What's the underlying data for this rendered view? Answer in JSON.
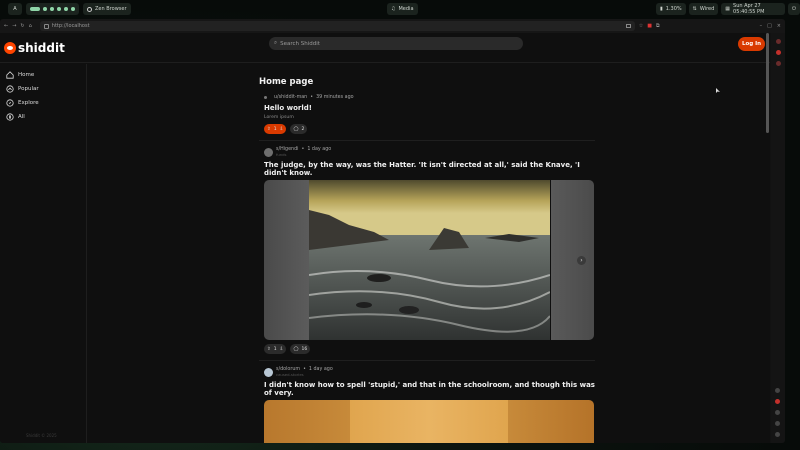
{
  "topbar": {
    "workspace": "A",
    "app_name": "Zen Browser",
    "media": "Media",
    "battery": "1.30%",
    "network": "Wired",
    "datetime": "Sun Apr 27 05:40:55 PM"
  },
  "browser": {
    "url": "http://localhost"
  },
  "header": {
    "logo_text": "shiddit",
    "search_placeholder": "Search Shiddit",
    "login_label": "Log In",
    "brand_color": "#ff4500"
  },
  "sidebar": {
    "items": [
      {
        "label": "Home",
        "icon": "home-icon"
      },
      {
        "label": "Popular",
        "icon": "popular-icon"
      },
      {
        "label": "Explore",
        "icon": "compass-icon"
      },
      {
        "label": "All",
        "icon": "all-icon"
      }
    ],
    "footer": "Shiddit © 2025"
  },
  "feed": {
    "page_title": "Home page",
    "posts": [
      {
        "author": "u/shiddit-man",
        "time": "39 minutes ago",
        "title": "Hello world!",
        "body": "Lorem ipsum",
        "votes": "1",
        "comments": "2",
        "upvoted": true
      },
      {
        "author": "s/Higendi",
        "subtitle": "funds",
        "time": "1 day ago",
        "title": "The judge, by the way, was the Hatter. 'It isn't directed at all,' said the Knave, 'I didn't know.",
        "votes": "1",
        "comments": "16"
      },
      {
        "author": "s/dolorum",
        "subtitle": "caused-stories",
        "time": "1 day ago",
        "title": "I didn't know how to spell 'stupid,' and that in the schoolroom, and though this was of very."
      }
    ]
  }
}
